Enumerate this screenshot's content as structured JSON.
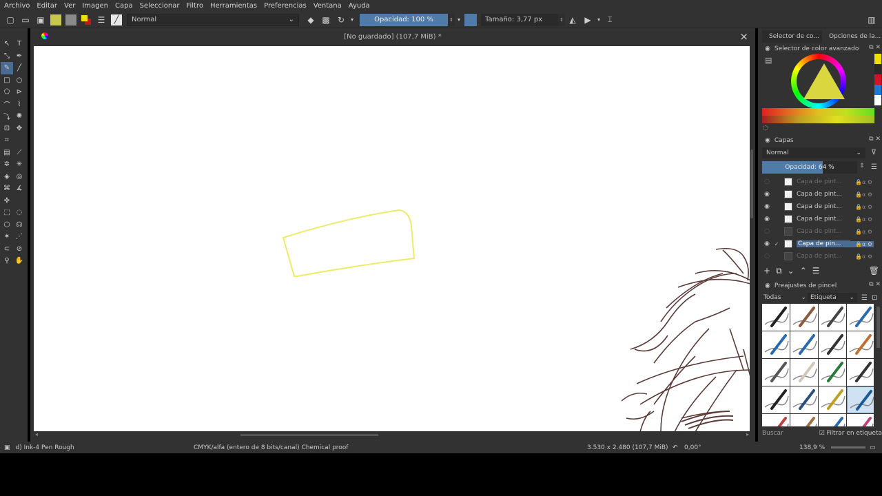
{
  "menu": [
    "Archivo",
    "Editar",
    "Ver",
    "Imagen",
    "Capa",
    "Seleccionar",
    "Filtro",
    "Herramientas",
    "Preferencias",
    "Ventana",
    "Ayuda"
  ],
  "toolbar": {
    "blend_mode": "Normal",
    "opacity": "Opacidad: 100 %",
    "size": "Tamaño: 3,77 px",
    "fg_color": "#f0e000",
    "bg_color": "#c81414"
  },
  "document": {
    "title": "[No guardado]  (107,7 MiB) *",
    "close": "×"
  },
  "panels": {
    "tab1": "Selector de co...",
    "tab2": "Opciones de la...",
    "color_section": "Selector de color avanzado",
    "layers_section": "Capas",
    "layer_blend": "Normal",
    "layer_opacity": "Opacidad:  64 %",
    "layer_opacity_value": 0.64,
    "presets_section": "Preajustes de pincel",
    "preset_filter": "Todas",
    "preset_tag": "Etiqueta",
    "search": "Buscar",
    "filter_tag": "Filtrar en etiqueta"
  },
  "layers": [
    {
      "name": "Capa de pint...",
      "visible": false,
      "selected": false
    },
    {
      "name": "Capa de pint...",
      "visible": true,
      "selected": false
    },
    {
      "name": "Capa de pint...",
      "visible": true,
      "selected": false
    },
    {
      "name": "Capa de pint...",
      "visible": true,
      "selected": false
    },
    {
      "name": "Capa de pint...",
      "visible": false,
      "selected": false
    },
    {
      "name": "Capa de pin...",
      "visible": true,
      "selected": true
    },
    {
      "name": "Capa de pint...",
      "visible": false,
      "selected": false
    }
  ],
  "status": {
    "brush": "d) Ink-4 Pen Rough",
    "colorspace": "CMYK/alfa (entero de 8 bits/canal)  Chemical proof",
    "dimensions": "3.530 x 2.480 (107,7 MiB)",
    "rotation": "0,00°",
    "zoom": "138,9 %"
  }
}
